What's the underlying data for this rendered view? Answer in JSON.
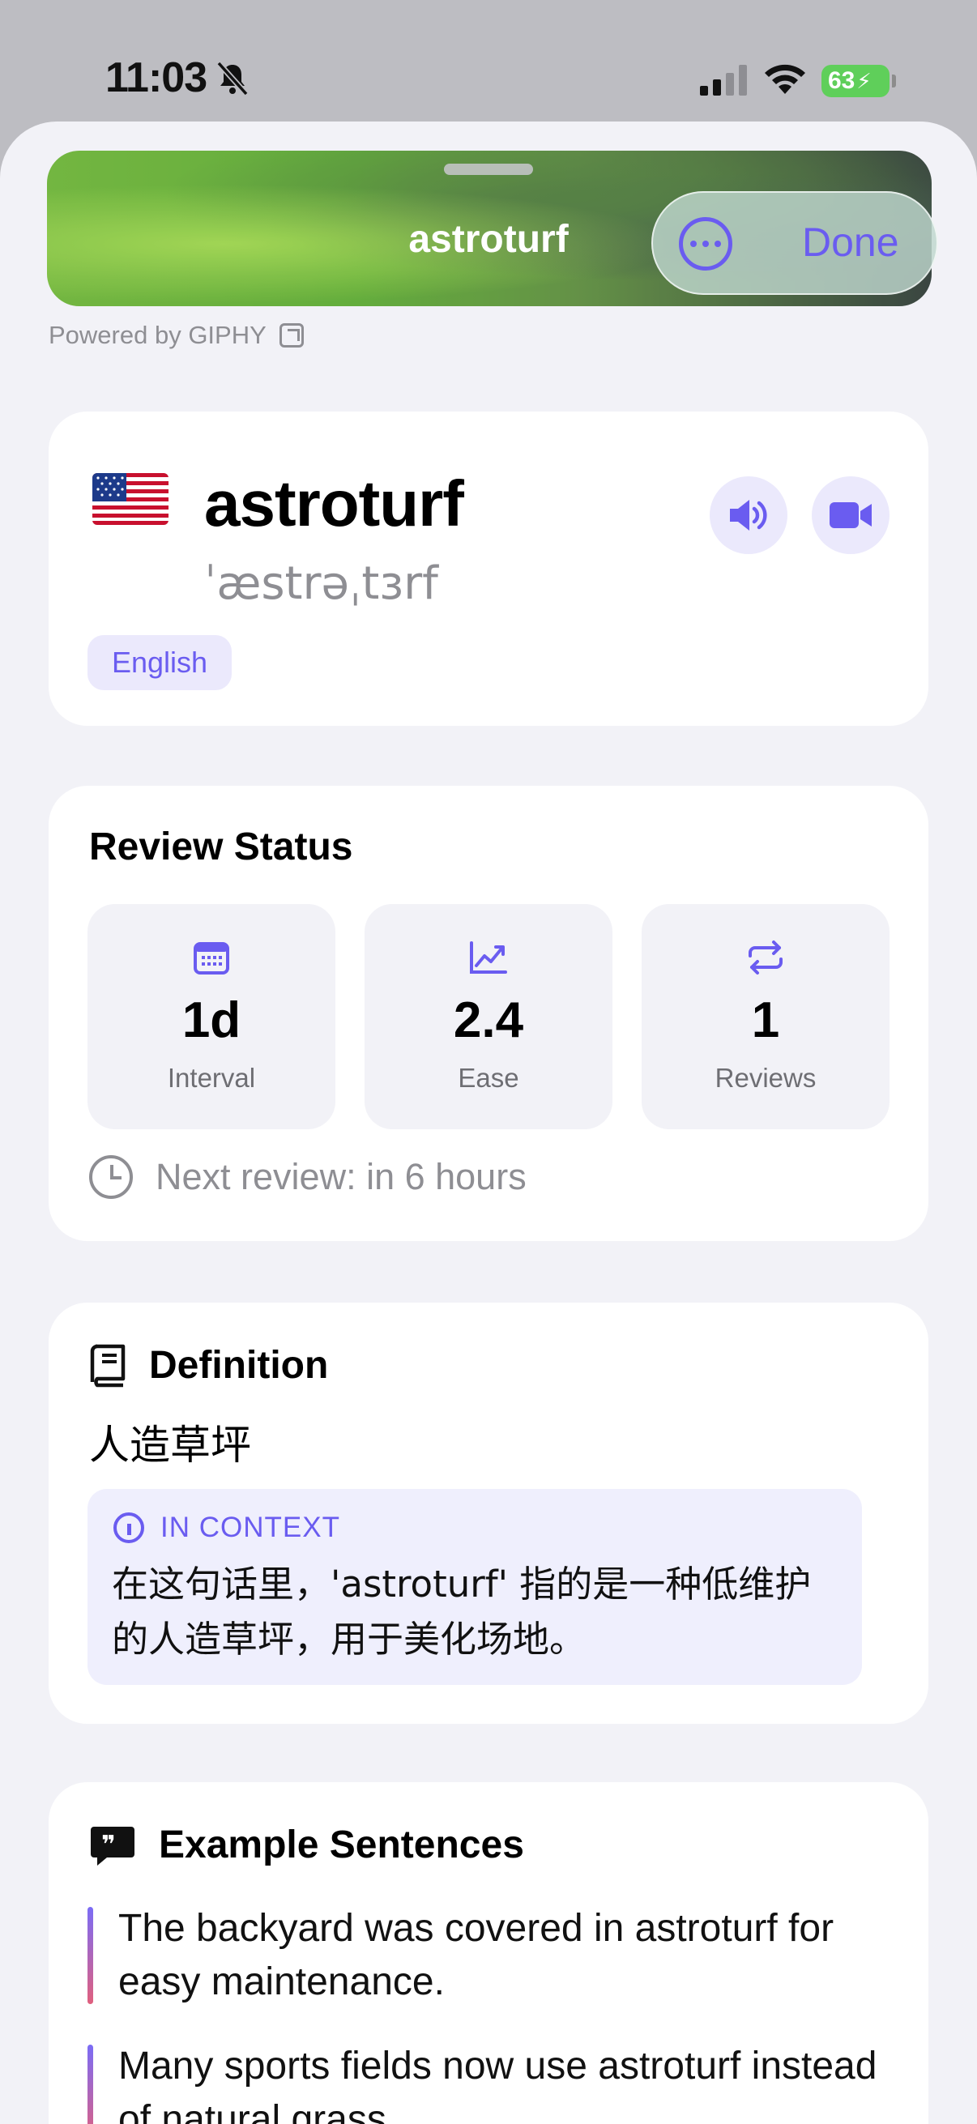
{
  "status_bar": {
    "time": "11:03",
    "battery": "63"
  },
  "header": {
    "title": "astroturf",
    "done_label": "Done",
    "powered_by": "Powered by GIPHY"
  },
  "word": {
    "term": "astroturf",
    "phonetic": "ˈæstrəˌtɜrf",
    "language": "English",
    "flag": "us-flag"
  },
  "review_status": {
    "title": "Review Status",
    "stats": [
      {
        "value": "1d",
        "label": "Interval",
        "icon": "calendar-icon"
      },
      {
        "value": "2.4",
        "label": "Ease",
        "icon": "chart-line-icon"
      },
      {
        "value": "1",
        "label": "Reviews",
        "icon": "repeat-icon"
      }
    ],
    "next_review": "Next review: in 6 hours"
  },
  "definition": {
    "title": "Definition",
    "text": "人造草坪",
    "context_label": "IN CONTEXT",
    "context_text": "在这句话里，'astroturf' 指的是一种低维护的人造草坪，用于美化场地。"
  },
  "examples": {
    "title": "Example Sentences",
    "items": [
      "The backyard was covered in astroturf for easy maintenance.",
      "Many sports fields now use astroturf instead of natural grass."
    ]
  },
  "colors": {
    "accent": "#6a5cf0",
    "background": "#f2f2f7",
    "battery": "#5fcf5a"
  }
}
